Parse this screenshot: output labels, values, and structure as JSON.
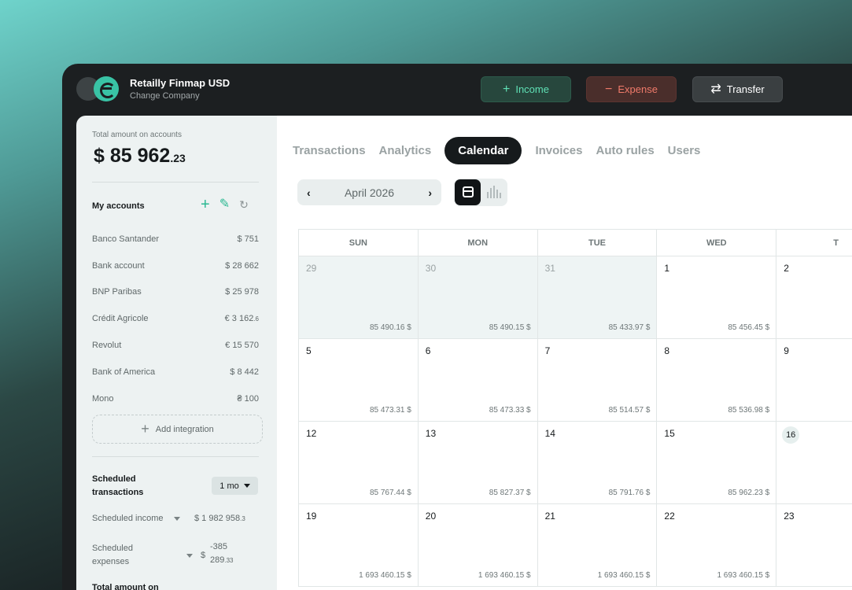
{
  "company": {
    "name": "Retailly Finmap USD",
    "change_label": "Change Company"
  },
  "header_buttons": {
    "income": "Income",
    "expense": "Expense",
    "transfer": "Transfer"
  },
  "sidebar": {
    "total_label": "Total amount on accounts",
    "total_main": "$ 85 962",
    "total_cents": ".23",
    "accounts_title": "My accounts",
    "accounts": [
      {
        "name": "Banco Santander",
        "amount": "$  751"
      },
      {
        "name": "Bank account",
        "amount": "$  28 662"
      },
      {
        "name": "BNP Paribas",
        "amount": "$  25 978"
      },
      {
        "name": "Crédit Agricole",
        "amount": "€ 3 162",
        "cents": ".6"
      },
      {
        "name": "Revolut",
        "amount": "€ 15 570"
      },
      {
        "name": "Bank of America",
        "amount": "$  8 442"
      },
      {
        "name": "Mono",
        "amount": "₴ 100"
      }
    ],
    "add_integration": "Add integration",
    "scheduled_title": "Scheduled transactions",
    "scheduled_period": "1 mo",
    "scheduled_income_label": "Scheduled income",
    "scheduled_income_value": "$ 1 982 958",
    "scheduled_income_cents": ".3",
    "scheduled_expenses_label": "Scheduled expenses",
    "scheduled_expenses_currency": "$",
    "scheduled_expenses_value1": "-385",
    "scheduled_expenses_value2": "289",
    "scheduled_expenses_cents": ".33",
    "total_amount_on": "Total amount on"
  },
  "tabs": [
    "Transactions",
    "Analytics",
    "Calendar",
    "Invoices",
    "Auto rules",
    "Users"
  ],
  "active_tab": "Calendar",
  "calendar": {
    "month": "April 2026",
    "weekdays": [
      "SUN",
      "MON",
      "TUE",
      "WED",
      "T"
    ],
    "weeks": [
      [
        {
          "day": "29",
          "bal": "85 490.16  $",
          "prev": true
        },
        {
          "day": "30",
          "bal": "85 490.15  $",
          "prev": true
        },
        {
          "day": "31",
          "bal": "85 433.97  $",
          "prev": true
        },
        {
          "day": "1",
          "bal": "85 456.45  $"
        },
        {
          "day": "2",
          "bal": ""
        }
      ],
      [
        {
          "day": "5",
          "bal": "85 473.31  $"
        },
        {
          "day": "6",
          "bal": "85 473.33  $"
        },
        {
          "day": "7",
          "bal": "85 514.57  $"
        },
        {
          "day": "8",
          "bal": "85 536.98  $"
        },
        {
          "day": "9",
          "bal": ""
        }
      ],
      [
        {
          "day": "12",
          "bal": "85 767.44  $"
        },
        {
          "day": "13",
          "bal": "85 827.37  $"
        },
        {
          "day": "14",
          "bal": "85 791.76  $"
        },
        {
          "day": "15",
          "bal": "85 962.23  $"
        },
        {
          "day": "16",
          "bal": "",
          "today": true
        }
      ],
      [
        {
          "day": "19",
          "bal": "1 693 460.15  $"
        },
        {
          "day": "20",
          "bal": "1 693 460.15  $"
        },
        {
          "day": "21",
          "bal": "1 693 460.15  $"
        },
        {
          "day": "22",
          "bal": "1 693 460.15  $"
        },
        {
          "day": "23",
          "bal": ""
        }
      ]
    ]
  }
}
